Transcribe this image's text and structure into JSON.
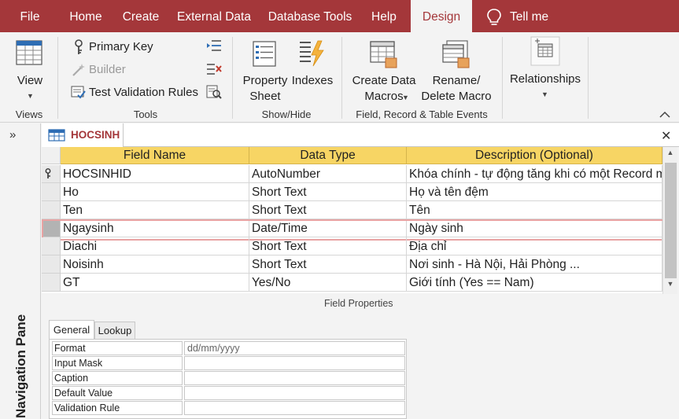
{
  "ribbon_tabs": [
    "File",
    "Home",
    "Create",
    "External Data",
    "Database Tools",
    "Help",
    "Design"
  ],
  "tell_me": "Tell me",
  "groups": {
    "views": {
      "label": "Views",
      "view_button": "View"
    },
    "tools": {
      "label": "Tools",
      "primary_key": "Primary Key",
      "builder": "Builder",
      "test_validation": "Test Validation Rules"
    },
    "show_hide": {
      "label": "Show/Hide",
      "property_sheet_line1": "Property",
      "property_sheet_line2": "Sheet",
      "indexes": "Indexes"
    },
    "events": {
      "label": "Field, Record & Table Events",
      "create_macros_line1": "Create Data",
      "create_macros_line2": "Macros",
      "rename_macro_line1": "Rename/",
      "rename_macro_line2": "Delete Macro"
    },
    "relationships": {
      "label": "Relationships"
    }
  },
  "nav_pane": {
    "label": "Navigation Pane",
    "toggle": "»"
  },
  "document_tab": {
    "title": "HOCSINH",
    "close": "✕"
  },
  "table_design": {
    "columns": [
      "Field Name",
      "Data Type",
      "Description (Optional)"
    ],
    "current_row": 3,
    "rows": [
      {
        "field": "HOCSINHID",
        "type": "AutoNumber",
        "desc": "Khóa chính - tự động tăng khi có một Record mới",
        "primary_key": true
      },
      {
        "field": "Ho",
        "type": "Short Text",
        "desc": "Họ và tên đệm"
      },
      {
        "field": "Ten",
        "type": "Short Text",
        "desc": "Tên"
      },
      {
        "field": "Ngaysinh",
        "type": "Date/Time",
        "desc": "Ngày sinh"
      },
      {
        "field": "Diachi",
        "type": "Short Text",
        "desc": "Địa chỉ"
      },
      {
        "field": "Noisinh",
        "type": "Short Text",
        "desc": "Nơi sinh - Hà Nội, Hải Phòng ..."
      },
      {
        "field": "GT",
        "type": "Yes/No",
        "desc": "Giới tính (Yes == Nam)"
      }
    ]
  },
  "field_properties": {
    "title": "Field Properties",
    "tabs": [
      "General",
      "Lookup"
    ],
    "rows": [
      {
        "name": "Format",
        "value": "dd/mm/yyyy"
      },
      {
        "name": "Input Mask",
        "value": ""
      },
      {
        "name": "Caption",
        "value": ""
      },
      {
        "name": "Default Value",
        "value": ""
      },
      {
        "name": "Validation Rule",
        "value": ""
      }
    ]
  },
  "colors": {
    "accent": "#a4373a",
    "header_yellow": "#f7d564",
    "selection_outline": "#e8a3a3"
  }
}
